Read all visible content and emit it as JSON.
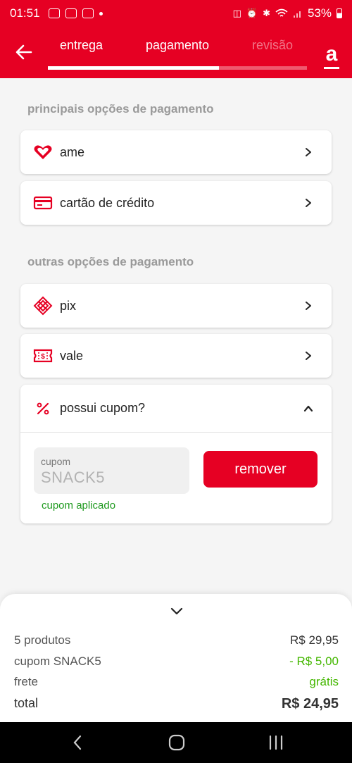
{
  "status_bar": {
    "time": "01:51",
    "battery": "53%",
    "icons": [
      "gallery-icon",
      "app-icon",
      "inter-app-icon",
      "notification-dot",
      "nfc-icon",
      "alarm-icon",
      "bluetooth-icon",
      "wifi-icon",
      "signal-icon",
      "battery-icon"
    ]
  },
  "header": {
    "tabs": [
      {
        "label": "entrega",
        "state": "done"
      },
      {
        "label": "pagamento",
        "state": "active"
      },
      {
        "label": "revisão",
        "state": "pending"
      }
    ],
    "progress": 0.66,
    "logo": "a",
    "accent_color": "#e60023"
  },
  "main_options": {
    "title": "principais opções de pagamento",
    "items": [
      {
        "label": "ame",
        "icon": "heart-icon"
      },
      {
        "label": "cartão de crédito",
        "icon": "credit-card-icon"
      }
    ]
  },
  "other_options": {
    "title": "outras opções de pagamento",
    "items": [
      {
        "label": "pix",
        "icon": "pix-icon"
      },
      {
        "label": "vale",
        "icon": "voucher-icon"
      }
    ]
  },
  "coupon": {
    "title": "possui cupom?",
    "icon": "percent-icon",
    "expanded": true,
    "field_label": "cupom",
    "field_value": "SNACK5",
    "remove_label": "remover",
    "status": "cupom aplicado"
  },
  "summary": {
    "rows": [
      {
        "label": "5 produtos",
        "value": "R$ 29,95"
      },
      {
        "label": "cupom SNACK5",
        "value": "- R$ 5,00"
      },
      {
        "label": "frete",
        "value": "grátis"
      }
    ],
    "total_label": "total",
    "total_value": "R$ 24,95",
    "discount_color": "#44b700"
  },
  "nav_bar": {
    "buttons": [
      "back-nav-icon",
      "home-nav-icon",
      "recents-nav-icon"
    ]
  }
}
